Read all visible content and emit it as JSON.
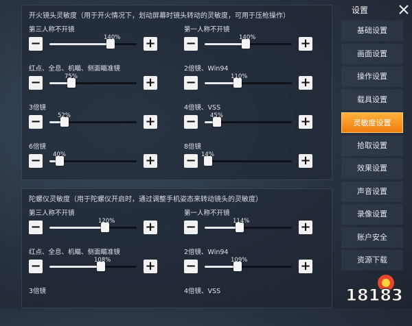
{
  "fire_section": {
    "header": "开火镜头灵敏度（用于开火情况下，划动屏幕时镜头转动的灵敏度，可用于压枪操作）",
    "sliders": [
      {
        "label": "第三人称不开镜",
        "value_text": "140%",
        "level": 0.7
      },
      {
        "label": "第一人称不开镜",
        "value_text": "140%",
        "level": 0.47
      },
      {
        "label": "红点、全息、机瞄、侧面瞄准镜",
        "value_text": "75%",
        "level": 0.25
      },
      {
        "label": "2倍镜、Win94",
        "value_text": "110%",
        "level": 0.38
      },
      {
        "label": "3倍镜",
        "value_text": "52%",
        "level": 0.17
      },
      {
        "label": "4倍镜、VSS",
        "value_text": "45%",
        "level": 0.14
      },
      {
        "label": "6倍镜",
        "value_text": "40%",
        "level": 0.12
      },
      {
        "label": "8倍镜",
        "value_text": "14%",
        "level": 0.04
      }
    ]
  },
  "gyro_section": {
    "header": "陀螺仪灵敏度（用于陀螺仪开启时，通过调整手机姿态来转动镜头的灵敏度）",
    "sliders": [
      {
        "label": "第三人称不开镜",
        "value_text": "120%",
        "level": 0.64
      },
      {
        "label": "第一人称不开镜",
        "value_text": "114%",
        "level": 0.4
      },
      {
        "label": "红点、全息、机瞄、侧面瞄准镜",
        "value_text": "108%",
        "level": 0.59
      },
      {
        "label": "2倍镜、Win94",
        "value_text": "109%",
        "level": 0.38
      },
      {
        "label": "3倍镜",
        "value_text": "",
        "level": null
      },
      {
        "label": "4倍镜、VSS",
        "value_text": "",
        "level": null
      }
    ]
  },
  "sidebar": {
    "title": "设置",
    "close_icon": "close-icon",
    "items": [
      {
        "label": "基础设置",
        "active": false
      },
      {
        "label": "画面设置",
        "active": false
      },
      {
        "label": "操作设置",
        "active": false
      },
      {
        "label": "载具设置",
        "active": false
      },
      {
        "label": "灵敏度设置",
        "active": true
      },
      {
        "label": "拾取设置",
        "active": false
      },
      {
        "label": "效果设置",
        "active": false
      },
      {
        "label": "声音设置",
        "active": false
      },
      {
        "label": "录像设置",
        "active": false
      },
      {
        "label": "账户安全",
        "active": false
      },
      {
        "label": "资源下载",
        "active": false
      }
    ]
  },
  "watermark": {
    "text": "18183"
  },
  "colors": {
    "accent": "#f39a1e",
    "panel": "#1e2632"
  }
}
